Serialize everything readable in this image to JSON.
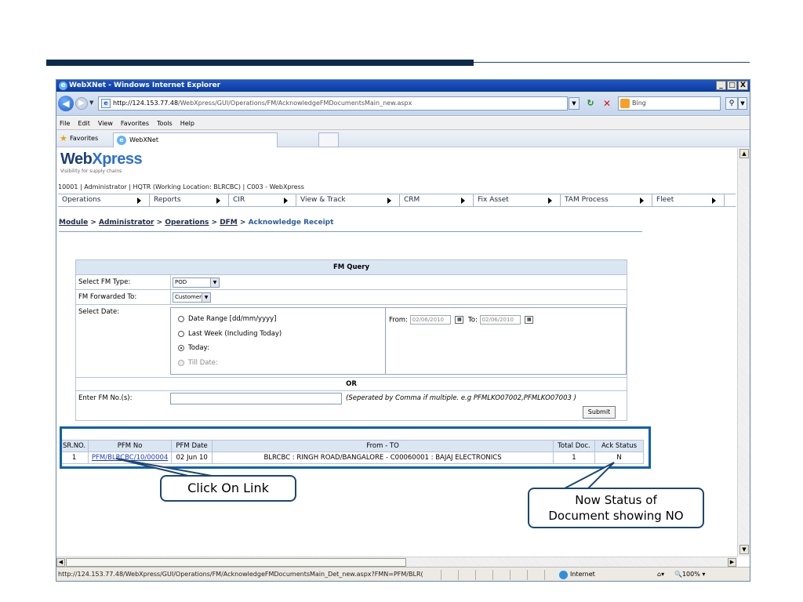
{
  "browser": {
    "title": "WebXNet - Windows Internet Explorer",
    "window_buttons": [
      "_",
      "□",
      "X"
    ],
    "url_prefix": "http://124.153.77.48",
    "url_path": "/WebXpress/GUI/Operations/FM/AcknowledgeFMDocumentsMain_new.aspx",
    "search_placeholder": "Bing",
    "menu": [
      "File",
      "Edit",
      "View",
      "Favorites",
      "Tools",
      "Help"
    ],
    "favorites_label": "Favorites",
    "tab_title": "WebXNet",
    "status_url": "http://124.153.77.48/WebXpress/GUI/Operations/FM/AcknowledgeFMDocumentsMain_Det_new.aspx?FMN=PFM/BLR(",
    "status_zone": "Internet",
    "status_zoom": "100%"
  },
  "page": {
    "brand_a": "Web",
    "brand_b": "Xpress",
    "tagline": "Visibility for supply chains",
    "userline": "10001 | Administrator | HQTR (Working Location: BLRCBC) | C003 - WebXpress",
    "nav": [
      "Operations",
      "Reports",
      "CIR",
      "View & Track",
      "CRM",
      "Fix Asset",
      "TAM Process",
      "Fleet"
    ],
    "breadcrumb": {
      "module": "Module",
      "administrator": "Administrator",
      "operations": "Operations",
      "dfm": "DFM",
      "sep": ">",
      "current": "Acknowledge Receipt"
    }
  },
  "fm_query": {
    "title": "FM Query",
    "fm_type_label": "Select FM Type:",
    "fm_type_value": "POD",
    "forwarded_label": "FM Forwarded To:",
    "forwarded_value": "Customer",
    "date_label": "Select Date:",
    "options": [
      {
        "label": "Date Range [dd/mm/yyyy]",
        "checked": false,
        "disabled": false
      },
      {
        "label": "Last Week (Including Today)",
        "checked": false,
        "disabled": false
      },
      {
        "label": "Today:",
        "checked": true,
        "disabled": false
      },
      {
        "label": "Till Date:",
        "checked": false,
        "disabled": true
      }
    ],
    "from_label": "From:",
    "from_value": "02/06/2010",
    "to_label": "To:",
    "to_value": "02/06/2010",
    "or_label": "OR",
    "fm_no_label": "Enter FM No.(s):",
    "fm_no_hint": "(Seperated by Comma if multiple. e.g PFMLKO07002,PFMLKO07003 )",
    "submit_label": "Submit"
  },
  "results": {
    "headers": [
      "SR.NO.",
      "PFM No",
      "PFM Date",
      "From - TO",
      "Total Doc.",
      "Ack Status"
    ],
    "rows": [
      {
        "sr": "1",
        "pfm_no": "PFM/BLRCBC/10/00004",
        "pfm_date": "02 Jun 10",
        "from_to": "BLRCBC : RINGH ROAD/BANGALORE - C00060001 : BAJAJ ELECTRONICS",
        "total_doc": "1",
        "ack_status": "N"
      }
    ]
  },
  "annotations": {
    "left_callout": "Click On Link",
    "right_callout_line1": "Now Status of",
    "right_callout_line2": "Document showing NO"
  },
  "colors": {
    "slide_bar": "#0d2a4a",
    "header_fill": "#dbe6f3",
    "highlight": "#0f5fae",
    "link": "#1a3cc7"
  }
}
